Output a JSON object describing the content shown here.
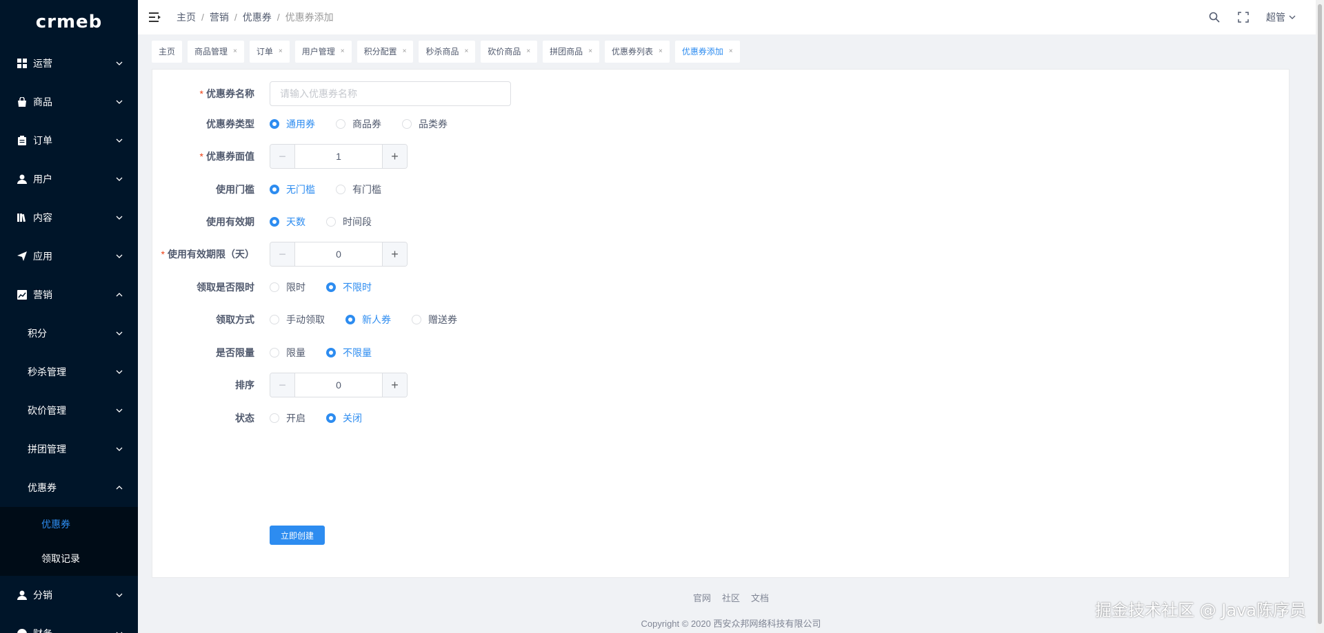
{
  "logo": "crmeb",
  "sidebar": {
    "items": [
      {
        "label": "运营",
        "icon": "grid-icon"
      },
      {
        "label": "商品",
        "icon": "bag-icon"
      },
      {
        "label": "订单",
        "icon": "clipboard-icon"
      },
      {
        "label": "用户",
        "icon": "user-icon"
      },
      {
        "label": "内容",
        "icon": "book-icon"
      },
      {
        "label": "应用",
        "icon": "paper-plane-icon"
      },
      {
        "label": "营销",
        "icon": "chart-icon"
      }
    ],
    "marketing_children": [
      "积分",
      "秒杀管理",
      "砍价管理",
      "拼团管理",
      "优惠券"
    ],
    "coupon_children": [
      "优惠券",
      "领取记录"
    ],
    "after": [
      {
        "label": "分销",
        "icon": "user-icon"
      },
      {
        "label": "财务",
        "icon": "money-icon"
      }
    ]
  },
  "header": {
    "breadcrumb": [
      "主页",
      "营销",
      "优惠券",
      "优惠券添加"
    ],
    "user": "超管"
  },
  "tags": [
    "主页",
    "商品管理",
    "订单",
    "用户管理",
    "积分配置",
    "秒杀商品",
    "砍价商品",
    "拼团商品",
    "优惠券列表",
    "优惠券添加"
  ],
  "form": {
    "name": {
      "label": "优惠券名称",
      "placeholder": "请输入优惠券名称"
    },
    "type": {
      "label": "优惠券类型",
      "options": [
        "通用券",
        "商品券",
        "品类券"
      ],
      "selected": 0
    },
    "value": {
      "label": "优惠券面值",
      "value": "1"
    },
    "threshold": {
      "label": "使用门槛",
      "options": [
        "无门槛",
        "有门槛"
      ],
      "selected": 0
    },
    "validity": {
      "label": "使用有效期",
      "options": [
        "天数",
        "时间段"
      ],
      "selected": 0
    },
    "days": {
      "label": "使用有效期限（天）",
      "value": "0"
    },
    "limit_time": {
      "label": "领取是否限时",
      "options": [
        "限时",
        "不限时"
      ],
      "selected": 1
    },
    "method": {
      "label": "领取方式",
      "options": [
        "手动领取",
        "新人券",
        "赠送券"
      ],
      "selected": 1
    },
    "limit_qty": {
      "label": "是否限量",
      "options": [
        "限量",
        "不限量"
      ],
      "selected": 1
    },
    "sort": {
      "label": "排序",
      "value": "0"
    },
    "status": {
      "label": "状态",
      "options": [
        "开启",
        "关闭"
      ],
      "selected": 1
    },
    "submit": "立即创建"
  },
  "footer": {
    "links": [
      "官网",
      "社区",
      "文档"
    ],
    "copyright": "Copyright © 2020 西安众邦网络科技有限公司"
  },
  "watermark": "掘金技术社区 @ Java陈序员",
  "colors": {
    "sidebar_bg": "#001529",
    "accent": "#2d8cf0",
    "required": "#ed4014"
  }
}
